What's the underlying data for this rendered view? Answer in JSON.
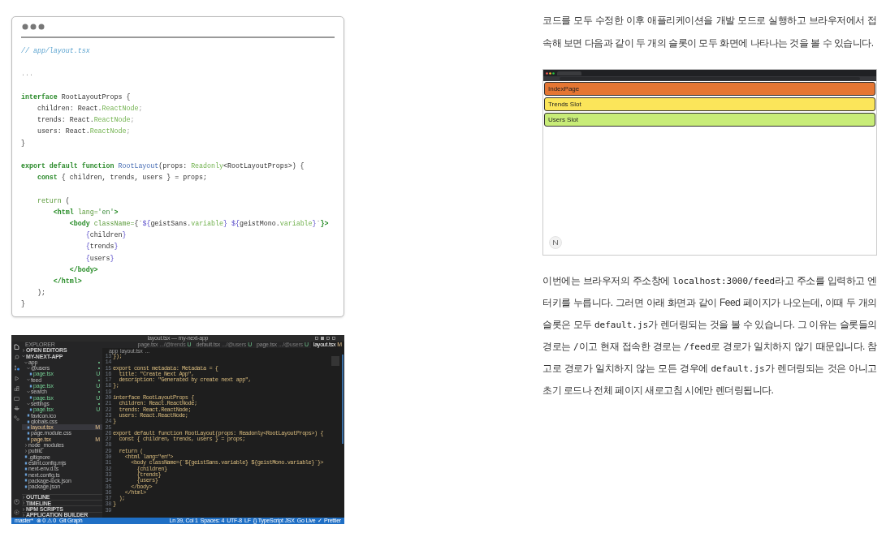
{
  "code_block": {
    "lines": [
      {
        "tokens": [
          {
            "text": "// app/layout.tsx",
            "kind": "comment"
          }
        ]
      },
      {
        "kind": "blank"
      },
      {
        "tokens": [
          {
            "text": "...",
            "kind": "punct"
          }
        ]
      },
      {
        "kind": "blank"
      },
      {
        "tokens": [
          {
            "text": "interface",
            "kind": "kw"
          },
          {
            "text": " RootLayoutProps {",
            "kind": "plain"
          }
        ]
      },
      {
        "tokens": [
          {
            "text": "    children: React.",
            "kind": "plain"
          },
          {
            "text": "ReactNode",
            "kind": "type"
          },
          {
            "text": ";",
            "kind": "punct"
          }
        ]
      },
      {
        "tokens": [
          {
            "text": "    trends: React.",
            "kind": "plain"
          },
          {
            "text": "ReactNode",
            "kind": "type"
          },
          {
            "text": ";",
            "kind": "punct"
          }
        ]
      },
      {
        "tokens": [
          {
            "text": "    users: React.",
            "kind": "plain"
          },
          {
            "text": "ReactNode",
            "kind": "type"
          },
          {
            "text": ";",
            "kind": "punct"
          }
        ]
      },
      {
        "tokens": [
          {
            "text": "}",
            "kind": "plain"
          }
        ]
      },
      {
        "kind": "blank"
      },
      {
        "tokens": [
          {
            "text": "export default function ",
            "kind": "kw"
          },
          {
            "text": "RootLayout",
            "kind": "fn"
          },
          {
            "text": "(props: ",
            "kind": "plain"
          },
          {
            "text": "Readonly",
            "kind": "type"
          },
          {
            "text": "<RootLayoutProps>) {",
            "kind": "plain"
          }
        ]
      },
      {
        "tokens": [
          {
            "text": "    const",
            "kind": "kw"
          },
          {
            "text": " { children, trends, users } = props;",
            "kind": "plain"
          }
        ]
      },
      {
        "kind": "blank"
      },
      {
        "tokens": [
          {
            "text": "    return",
            "kind": "attr"
          },
          {
            "text": " (",
            "kind": "plain"
          }
        ]
      },
      {
        "tokens": [
          {
            "text": "        <html",
            "kind": "tag"
          },
          {
            "text": " lang=",
            "kind": "attr"
          },
          {
            "text": "'en'",
            "kind": "str"
          },
          {
            "text": ">",
            "kind": "tag"
          }
        ]
      },
      {
        "tokens": [
          {
            "text": "            <body",
            "kind": "tag"
          },
          {
            "text": " className=",
            "kind": "attr"
          },
          {
            "text": "{`",
            "kind": "plain"
          },
          {
            "text": "${",
            "kind": "brace"
          },
          {
            "text": "geistSans.",
            "kind": "plain"
          },
          {
            "text": "variable",
            "kind": "type"
          },
          {
            "text": "}",
            "kind": "brace"
          },
          {
            "text": " ${",
            "kind": "brace"
          },
          {
            "text": "geistMono.",
            "kind": "plain"
          },
          {
            "text": "variable",
            "kind": "type"
          },
          {
            "text": "}",
            "kind": "brace"
          },
          {
            "text": "`",
            "kind": "plain"
          },
          {
            "text": "}>",
            "kind": "tag"
          }
        ]
      },
      {
        "tokens": [
          {
            "text": "                {",
            "kind": "brace"
          },
          {
            "text": "children",
            "kind": "plain"
          },
          {
            "text": "}",
            "kind": "brace"
          }
        ]
      },
      {
        "tokens": [
          {
            "text": "                {",
            "kind": "brace"
          },
          {
            "text": "trends",
            "kind": "plain"
          },
          {
            "text": "}",
            "kind": "brace"
          }
        ]
      },
      {
        "tokens": [
          {
            "text": "                {",
            "kind": "brace"
          },
          {
            "text": "users",
            "kind": "plain"
          },
          {
            "text": "}",
            "kind": "brace"
          }
        ]
      },
      {
        "tokens": [
          {
            "text": "            </body>",
            "kind": "tag"
          }
        ]
      },
      {
        "tokens": [
          {
            "text": "        </html>",
            "kind": "tag"
          }
        ]
      },
      {
        "tokens": [
          {
            "text": "    );",
            "kind": "plain"
          }
        ]
      },
      {
        "tokens": [
          {
            "text": "}",
            "kind": "plain"
          }
        ]
      }
    ]
  },
  "editor_screenshot": {
    "title": "layout.tsx — my-next-app",
    "explorer_title": "EXPLORER",
    "sections_top": [
      {
        "label": "OPEN EDITORS",
        "expanded": false
      },
      {
        "label": "MY-NEXT-APP",
        "expanded": true
      }
    ],
    "tree": [
      {
        "label": "app",
        "kind": "folder",
        "expanded": true,
        "badge": "•",
        "selected": false,
        "children": [
          {
            "label": "@users",
            "kind": "folder",
            "expanded": true,
            "badge": "•",
            "selected": false,
            "children": [
              {
                "label": "page.tsx",
                "kind": "file",
                "badge": "U",
                "selected": false
              }
            ]
          },
          {
            "label": "feed",
            "kind": "folder",
            "expanded": true,
            "badge": "•",
            "selected": false,
            "children": [
              {
                "label": "page.tsx",
                "kind": "file",
                "badge": "U",
                "selected": false
              }
            ]
          },
          {
            "label": "search",
            "kind": "folder",
            "expanded": true,
            "badge": "•",
            "selected": false,
            "children": [
              {
                "label": "page.tsx",
                "kind": "file",
                "badge": "U",
                "selected": false
              }
            ]
          },
          {
            "label": "settings",
            "kind": "folder",
            "expanded": true,
            "badge": "•",
            "selected": false,
            "children": [
              {
                "label": "page.tsx",
                "kind": "file",
                "badge": "U",
                "selected": false
              }
            ]
          },
          {
            "label": "favicon.ico",
            "kind": "file",
            "selected": false
          },
          {
            "label": "globals.css",
            "kind": "file",
            "selected": false
          },
          {
            "label": "layout.tsx",
            "kind": "file",
            "badge": "M",
            "selected": true
          },
          {
            "label": "page.module.css",
            "kind": "file",
            "selected": false
          },
          {
            "label": "page.tsx",
            "kind": "file",
            "badge": "M",
            "selected": false
          }
        ]
      },
      {
        "label": "node_modules",
        "kind": "folder",
        "expanded": false,
        "selected": false
      },
      {
        "label": "public",
        "kind": "folder",
        "expanded": false,
        "selected": false
      },
      {
        "label": ".gitignore",
        "kind": "file",
        "selected": false
      },
      {
        "label": "eslint.config.mjs",
        "kind": "file",
        "selected": false
      },
      {
        "label": "next-env.d.ts",
        "kind": "file",
        "selected": false
      },
      {
        "label": "next.config.ts",
        "kind": "file",
        "selected": false
      },
      {
        "label": "package-lock.json",
        "kind": "file",
        "selected": false
      },
      {
        "label": "package.json",
        "kind": "file",
        "selected": false
      }
    ],
    "sections_bottom": [
      {
        "label": "OUTLINE",
        "expanded": false
      },
      {
        "label": "TIMELINE",
        "expanded": false
      },
      {
        "label": "NPM SCRIPTS",
        "expanded": false
      },
      {
        "label": "APPLICATION BUILDER",
        "expanded": false
      }
    ],
    "tabs": [
      {
        "label": "page.tsx",
        "path": ".../@trends",
        "badge": "U",
        "selected": false
      },
      {
        "label": "default.tsx",
        "path": ".../@users",
        "badge": "U",
        "selected": false
      },
      {
        "label": "page.tsx",
        "path": ".../@users",
        "badge": "U",
        "selected": false
      },
      {
        "label": "layout.tsx",
        "badge": "M",
        "selected": true
      }
    ],
    "breadcrumb": [
      "app",
      "layout.tsx",
      "..."
    ],
    "code": [
      {
        "n": "13",
        "text": "});"
      },
      {
        "n": "14"
      },
      {
        "n": "15",
        "text": "export const metadata: Metadata = {"
      },
      {
        "n": "16",
        "text": "  title: \"Create Next App\","
      },
      {
        "n": "17",
        "text": "  description: \"Generated by create next app\","
      },
      {
        "n": "18",
        "text": "};"
      },
      {
        "n": "19"
      },
      {
        "n": "20",
        "text": "interface RootLayoutProps {"
      },
      {
        "n": "21",
        "text": "  children: React.ReactNode;"
      },
      {
        "n": "22",
        "text": "  trends: React.ReactNode;"
      },
      {
        "n": "23",
        "text": "  users: React.ReactNode;"
      },
      {
        "n": "24",
        "text": "}"
      },
      {
        "n": "25"
      },
      {
        "n": "26",
        "text": "export default function RootLayout(props: Readonly<RootLayoutProps>) {"
      },
      {
        "n": "27",
        "text": "  const { children, trends, users } = props;"
      },
      {
        "n": "28"
      },
      {
        "n": "29",
        "text": "  return ("
      },
      {
        "n": "30",
        "text": "    <html lang=\"en\">"
      },
      {
        "n": "31",
        "text": "      <body className={`${geistSans.variable} ${geistMono.variable}`}>"
      },
      {
        "n": "32",
        "text": "        {children}"
      },
      {
        "n": "33",
        "text": "        {trends}"
      },
      {
        "n": "34",
        "text": "        {users}"
      },
      {
        "n": "35",
        "text": "      </body>"
      },
      {
        "n": "36",
        "text": "    </html>"
      },
      {
        "n": "37",
        "text": "  );"
      },
      {
        "n": "38",
        "text": "}"
      },
      {
        "n": "39"
      }
    ],
    "status_left": [
      "master*",
      "⊗ 0 ⚠ 0",
      "Git Graph"
    ],
    "status_right": [
      "Ln 39, Col 1",
      "Spaces: 4",
      "UTF-8",
      "LF",
      "{} TypeScript JSX",
      "Go Live",
      "✓ Prettier"
    ]
  },
  "paragraph_1": [
    {
      "text": "코드를 모두 수정한 이후 애플리케이션을 개발 모드로 실행하고 브라우저에서 접속해 보면 다음과 같이 두 개의 슬롯이 모두 화면에 나타나는 것을 볼 수 있습니다."
    }
  ],
  "browser_screenshot": {
    "slots": [
      {
        "label": "IndexPage",
        "color": "#e57633"
      },
      {
        "label": "Trends Slot",
        "color": "#fbe55a"
      },
      {
        "label": "Users Slot",
        "color": "#c8ec78"
      }
    ]
  },
  "paragraph_2": [
    {
      "text": "이번에는 브라우저의 주소창에 "
    },
    {
      "text": "localhost:3000/feed",
      "code": true
    },
    {
      "text": "라고 주소를 입력하고 엔터키를 누릅니다. 그러면 아래 화면과 같이 Feed 페이지가 나오는데, 이때 두 개의 슬롯은 모두 "
    },
    {
      "text": "default.js",
      "code": true
    },
    {
      "text": "가 렌더링되는 것을 볼 수 있습니다. 그 이유는 슬롯들의 경로는 "
    },
    {
      "text": "/",
      "code": true
    },
    {
      "text": "이고 현재 접속한 경로는 "
    },
    {
      "text": "/feed",
      "code": true
    },
    {
      "text": "로 경로가 일치하지 않기 때문입니다. 참고로 경로가 일치하지 않는 모든 경우에 "
    },
    {
      "text": "default.js",
      "code": true
    },
    {
      "text": "가 렌더링되는 것은 아니고 초기 로드나 전체 페이지 새로고침 시에만 렌더링됩니다."
    }
  ]
}
